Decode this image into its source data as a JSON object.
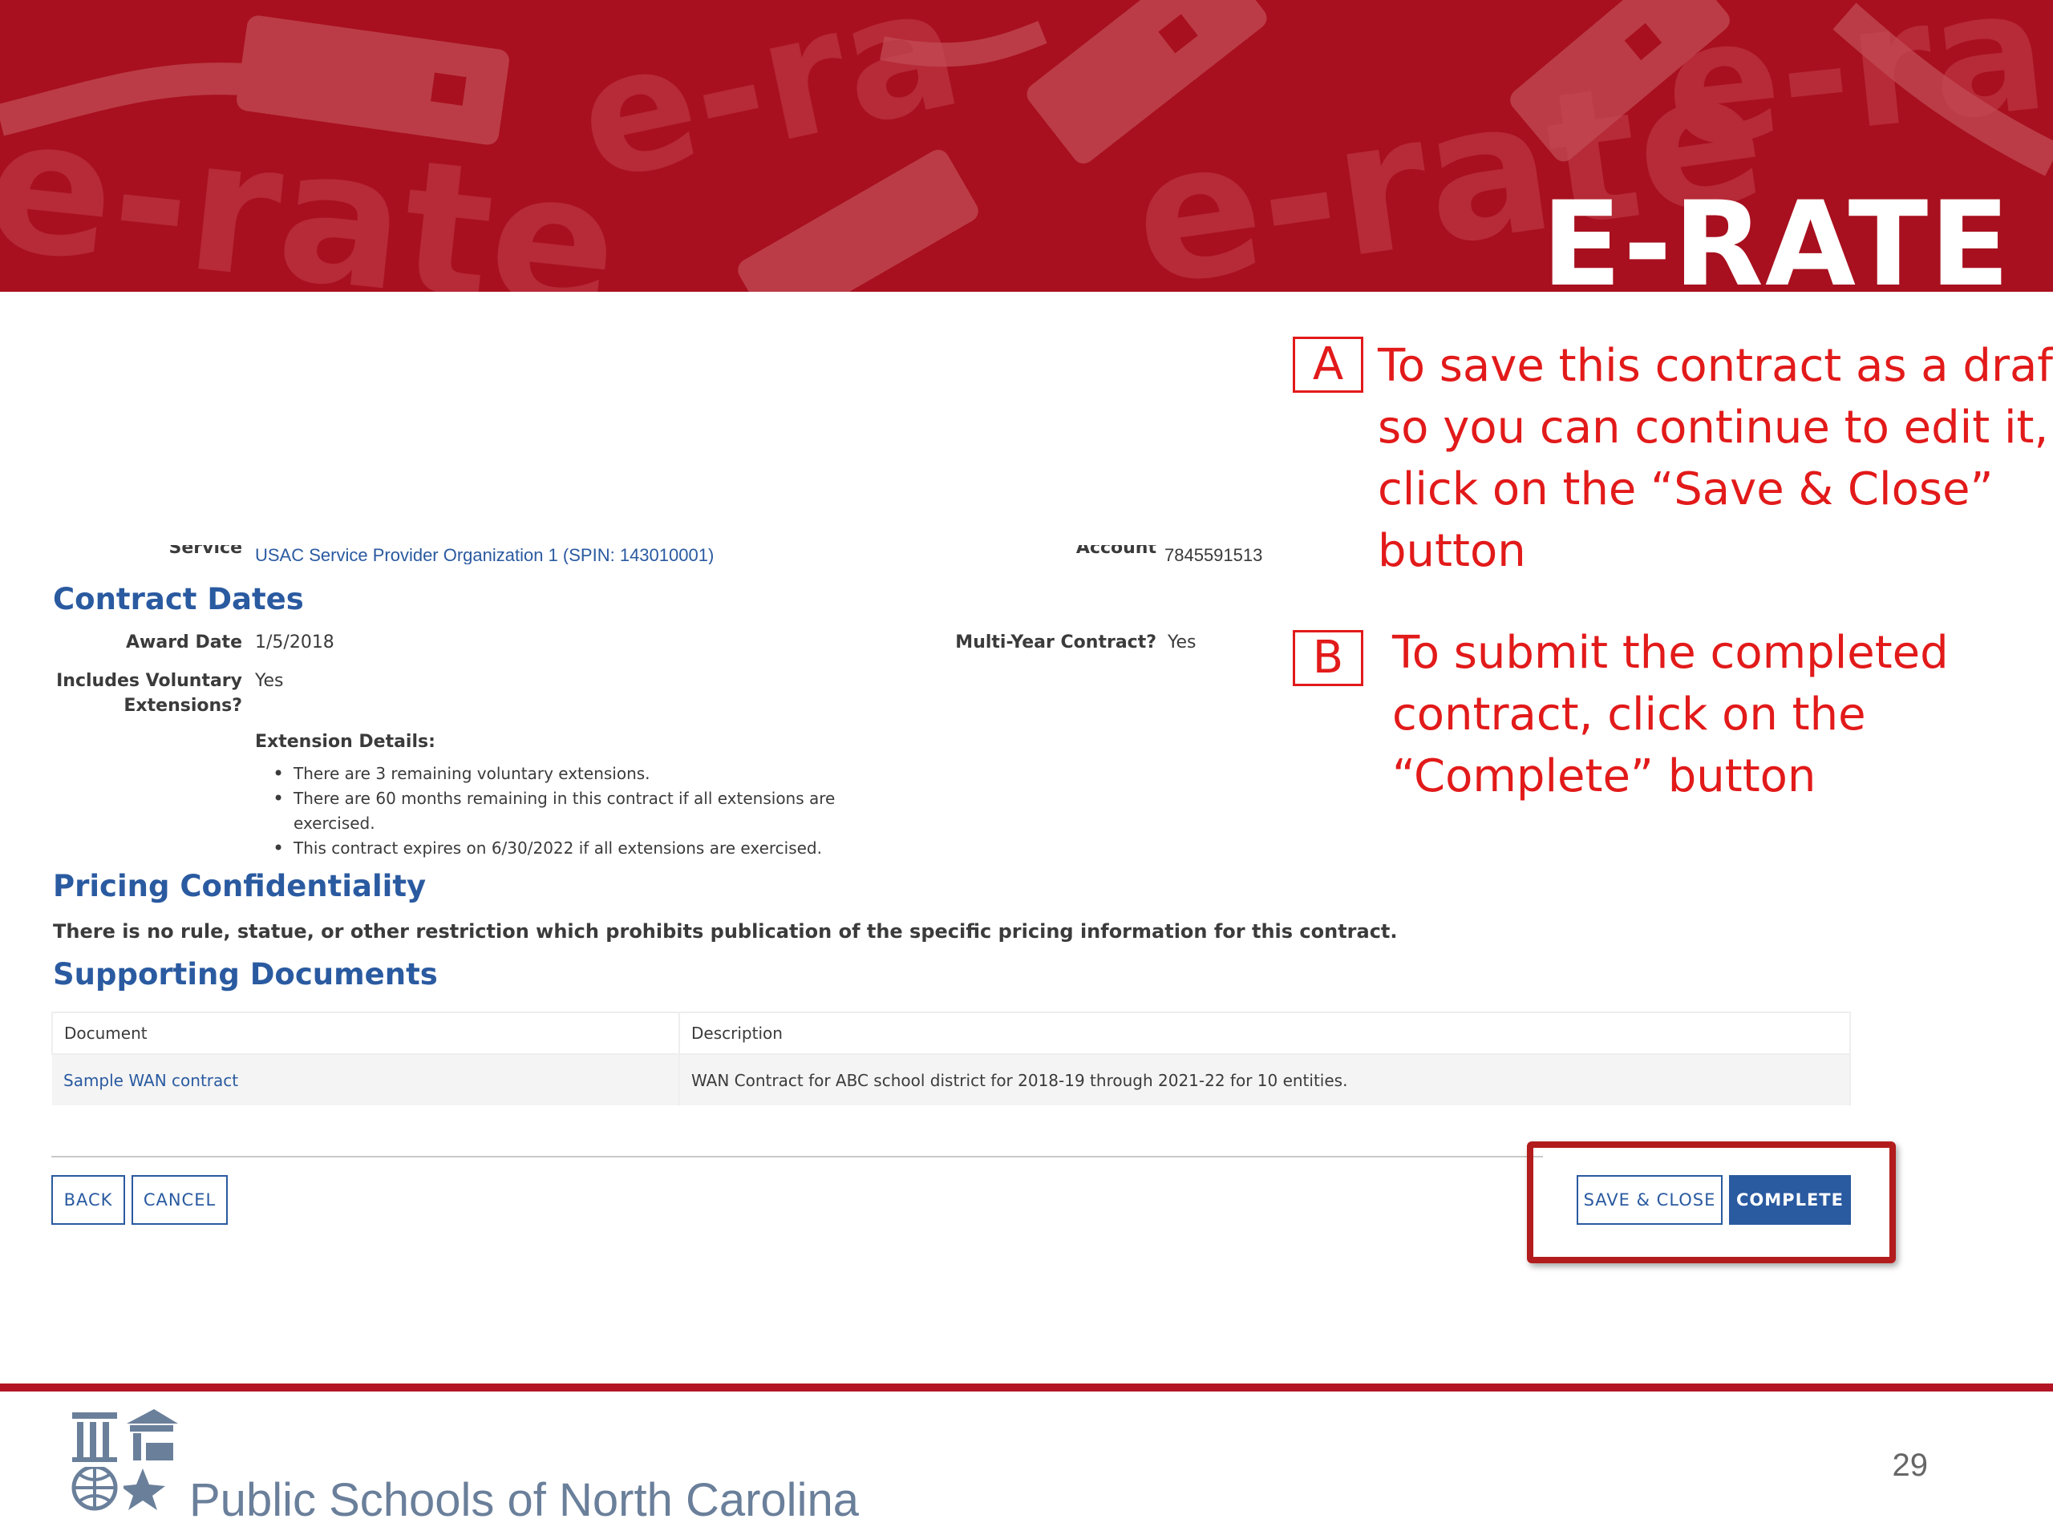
{
  "banner": {
    "title": "E-RATE",
    "watermark_texts": [
      "e-rate",
      "e-ra",
      "e-rate",
      "e-ra"
    ]
  },
  "callouts": [
    {
      "letter": "A",
      "lines": [
        "To save this contract as a draft",
        "so you can continue to edit it,",
        "click on the “Save & Close”",
        "button"
      ]
    },
    {
      "letter": "B",
      "lines": [
        "To submit the completed",
        "contract, click on the",
        "“Complete” button"
      ]
    }
  ],
  "form": {
    "cut_off_row": {
      "left_label": "Service Provider",
      "left_value": "USAC Service Provider Organization 1 (SPIN: 143010001)",
      "right_label": "Account Number",
      "right_value": "7845591513"
    },
    "contract_dates": {
      "heading": "Contract Dates",
      "award_date_label": "Award Date",
      "award_date_value": "1/5/2018",
      "multi_year_label": "Multi-Year Contract?",
      "multi_year_value": "Yes",
      "voluntary_label_line1": "Includes Voluntary",
      "voluntary_label_line2": "Extensions?",
      "voluntary_value": "Yes",
      "extension_details_label": "Extension Details:",
      "extension_items": [
        "There are 3 remaining voluntary extensions.",
        "There are 60 months remaining in this contract if all extensions are exercised.",
        "This contract expires on 6/30/2022 if all extensions are exercised."
      ]
    },
    "pricing": {
      "heading": "Pricing Confidentiality",
      "text": "There is no rule, statue, or other restriction which prohibits publication of the specific pricing information for this contract."
    },
    "documents": {
      "heading": "Supporting Documents",
      "columns": [
        "Document",
        "Description"
      ],
      "rows": [
        {
          "document": "Sample WAN contract",
          "description": "WAN Contract for ABC school district for 2018-19 through 2021-22 for 10 entities."
        }
      ]
    },
    "buttons": {
      "back": "BACK",
      "cancel": "CANCEL",
      "save_close": "SAVE & CLOSE",
      "complete": "COMPLETE"
    }
  },
  "footer": {
    "org_name": "Public Schools of North Carolina",
    "page_number": "29"
  },
  "colors": {
    "banner_red": "#a8101f",
    "callout_red": "#e21a1a",
    "highlight_box": "#b31c1c",
    "link_blue": "#2a5aa0",
    "footer_rule": "#b31524"
  }
}
